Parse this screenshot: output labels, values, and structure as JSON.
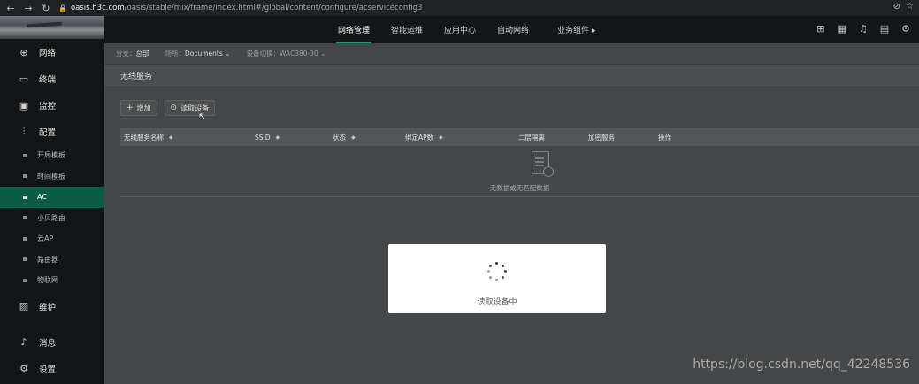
{
  "browser": {
    "url_host": "oasis.h3c.com",
    "url_path": "/oasis/stable/mix/frame/index.html#/global/content/configure/acserviceconfig3"
  },
  "sidebar": {
    "items": [
      {
        "label": "网络",
        "icon": "globe-icon"
      },
      {
        "label": "终端",
        "icon": "devices-icon"
      },
      {
        "label": "监控",
        "icon": "monitor-icon"
      },
      {
        "label": "配置",
        "icon": "sliders-icon"
      }
    ],
    "sub_items": [
      "开局模板",
      "时间模板",
      "AC",
      "小贝路由",
      "云AP",
      "路由器",
      "物联网"
    ],
    "active_sub": "AC",
    "bottom_items": [
      {
        "label": "维护",
        "icon": "maintain-icon"
      },
      {
        "label": "消息",
        "icon": "bell-icon"
      },
      {
        "label": "设置",
        "icon": "gear-icon"
      }
    ]
  },
  "topnav": {
    "items": [
      "网络管理",
      "智能运维",
      "应用中心",
      "自动网络",
      "业务组件 ▸"
    ],
    "active": "网络管理"
  },
  "filter": {
    "branch_label": "分支：",
    "branch_value": "总部",
    "site_label": "场所：",
    "site_value": "Documents",
    "device_label": "设备切换：",
    "device_value": "WAC380-30"
  },
  "section": {
    "title": "无线服务"
  },
  "buttons": {
    "add": "增加",
    "read": "读取设备"
  },
  "table": {
    "columns": [
      "无线服务名称",
      "SSID",
      "状态",
      "绑定AP数",
      "二层隔离",
      "加密服务",
      "操作"
    ],
    "empty_text": "无数据或无匹配数据"
  },
  "modal": {
    "text": "读取设备中"
  },
  "watermark": "https://blog.csdn.net/qq_42248536",
  "colors": {
    "accent": "#1b9a72",
    "active_bg": "#0a5c46"
  }
}
